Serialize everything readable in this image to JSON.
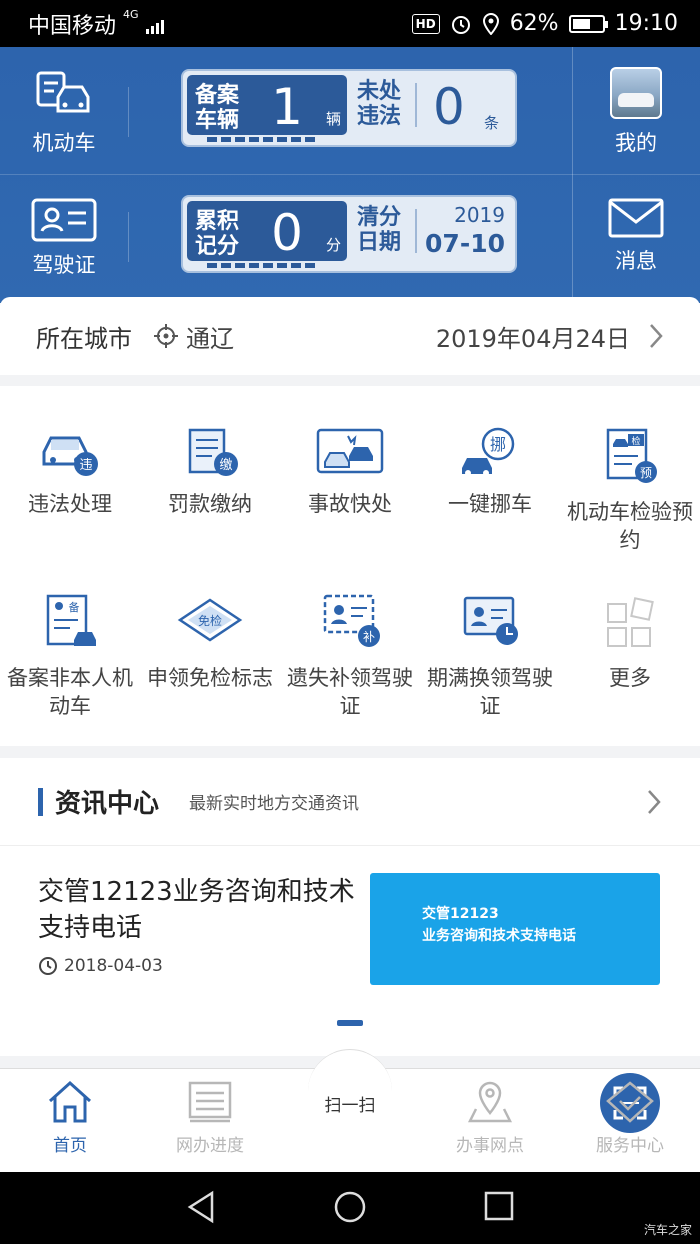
{
  "status_bar": {
    "carrier": "中国移动",
    "network": "4G",
    "hd": "HD",
    "battery": "62%",
    "battery_level": 0.62,
    "time": "19:10"
  },
  "header": {
    "vehicle": "机动车",
    "license": "驾驶证",
    "mine": "我的",
    "messages": "消息",
    "card1": {
      "left_label": "备案车辆",
      "left_value": "1",
      "left_unit": "辆",
      "right_label": "未处违法",
      "right_value": "0",
      "right_unit": "条"
    },
    "card2": {
      "left_label": "累积记分",
      "left_value": "0",
      "left_unit": "分",
      "right_label": "清分日期",
      "right_year": "2019",
      "right_date": "07-10"
    }
  },
  "city": {
    "label": "所在城市",
    "name": "通辽",
    "date": "2019年04月24日"
  },
  "services": [
    {
      "label": "违法处理",
      "icon": "car-violation-icon"
    },
    {
      "label": "罚款缴纳",
      "icon": "fine-payment-icon"
    },
    {
      "label": "事故快处",
      "icon": "accident-icon"
    },
    {
      "label": "一键挪车",
      "icon": "move-car-icon"
    },
    {
      "label": "机动车检验预约",
      "icon": "inspection-booking-icon"
    },
    {
      "label": "备案非本人机动车",
      "icon": "register-vehicle-icon"
    },
    {
      "label": "申领免检标志",
      "icon": "exempt-sticker-icon"
    },
    {
      "label": "遗失补领驾驶证",
      "icon": "reissue-license-icon"
    },
    {
      "label": "期满换领驾驶证",
      "icon": "renew-license-icon"
    },
    {
      "label": "更多",
      "icon": "more-grid-icon"
    }
  ],
  "news": {
    "title": "资讯中心",
    "subtitle": "最新实时地方交通资讯",
    "item": {
      "title": "交管12123业务咨询和技术支持电话",
      "date": "2018-04-03",
      "image_line1": "交管12123",
      "image_line2": "业务咨询和技术支持电话"
    }
  },
  "tabs": [
    {
      "label": "首页",
      "icon": "home-icon"
    },
    {
      "label": "网办进度",
      "icon": "progress-icon"
    },
    {
      "label": "扫一扫",
      "icon": "scan-icon"
    },
    {
      "label": "办事网点",
      "icon": "location-icon"
    },
    {
      "label": "服务中心",
      "icon": "service-center-icon"
    }
  ],
  "watermark": "汽车之家",
  "colors": {
    "primary": "#2d64ad",
    "header_bg": "#2f67af",
    "news_image_bg": "#1aa3e8"
  }
}
